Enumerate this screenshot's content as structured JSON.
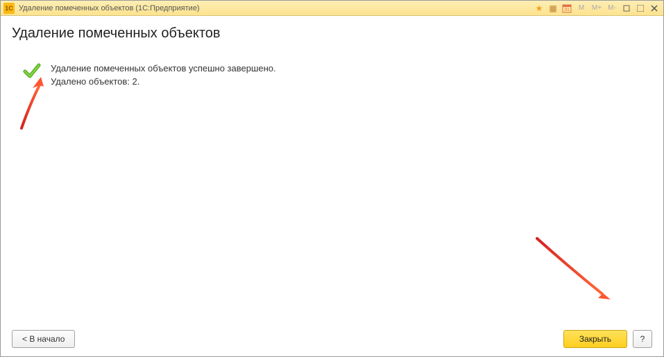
{
  "titlebar": {
    "icon_text": "1C",
    "title": "Удаление помеченных объектов  (1С:Предприятие)"
  },
  "page": {
    "title": "Удаление помеченных объектов"
  },
  "message": {
    "line1": "Удаление помеченных объектов успешно завершено.",
    "line2": "Удалено объектов: 2."
  },
  "footer": {
    "back_label": "< В начало",
    "close_label": "Закрыть",
    "help_label": "?"
  }
}
